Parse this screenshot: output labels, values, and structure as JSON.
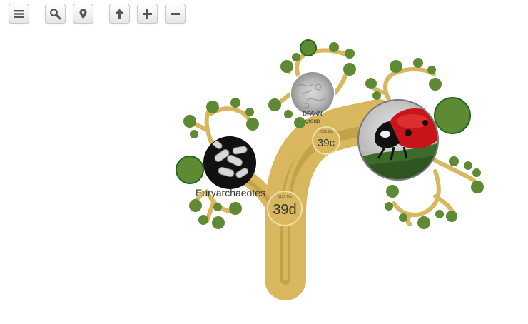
{
  "toolbar": {
    "buttons": [
      {
        "name": "menu-button",
        "icon": "menu-icon"
      },
      {
        "name": "search-button",
        "icon": "search-icon"
      },
      {
        "name": "location-button",
        "icon": "location-pin-icon"
      },
      {
        "name": "up-button",
        "icon": "arrow-up-icon"
      },
      {
        "name": "zoom-in-button",
        "icon": "plus-icon"
      },
      {
        "name": "zoom-out-button",
        "icon": "minus-icon"
      }
    ]
  },
  "tree": {
    "nodes": {
      "root": {
        "ma": "3125 Ma",
        "code": "39d"
      },
      "right": {
        "ma": "2025 Ma",
        "code": "39c"
      }
    },
    "labels": {
      "euryarchaeotes": "Euryarchaeotes",
      "dpann_line1": "DPANN",
      "dpann_line2": "group"
    }
  },
  "colors": {
    "trunk": "#d9b75e",
    "trunk_inner": "#c3a24a",
    "leaf": "#5e8a33",
    "leaf_dark": "#1f6b18",
    "circle_text": "#333333"
  }
}
